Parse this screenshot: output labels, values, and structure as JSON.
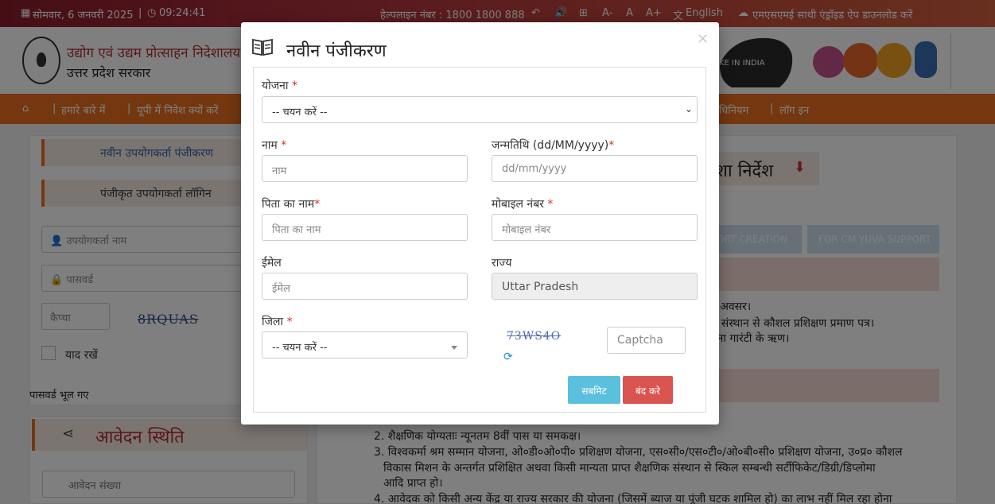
{
  "topbar": {
    "date": "सोमवार, 6 जनवरी 2025",
    "separator": "|",
    "time": "09:24:41",
    "helpline": "हेल्पलाइन नंबर : 1800 1800 888",
    "font_small": "A-",
    "font_normal": "A",
    "font_large": "A+",
    "language": "English",
    "app_download": "एमएसएमई साथी एंड्रॉइड ऐप डाउनलोड करें"
  },
  "header": {
    "department_line1": "उद्योग एवं उद्यम प्रोत्साहन निदेशालय",
    "department_line2": "उत्तर प्रदेश सरकार",
    "make_in_india": "KE IN INDIA"
  },
  "nav": {
    "items": [
      "हमारे बारे में",
      "यूपी में निवेश क्यों करें",
      "धिनियम",
      "लॉग इन"
    ]
  },
  "left_panel": {
    "tab_new_user": "नवीन उपयोगकर्ता पंजीकरण",
    "tab_login": "पंजीकृत उपयोगकर्ता लॉगिन",
    "username_placeholder": "उपयोगकर्ता नाम",
    "password_placeholder": "पासवर्ड",
    "captcha_placeholder": "कैप्चा",
    "captcha_text": "8RQUAS",
    "remember_label": "याद रखें",
    "forgot_password": "पासवर्ड भूल गए",
    "status_title": "आवेदन स्थिति",
    "application_number_placeholder": "आवेदन संख्या"
  },
  "right_panel": {
    "guidelines_title": "शा निर्देश",
    "button_project_report": "PORT CREATION",
    "button_cm_yuva": "FOR CM YUVA SUPPORT",
    "line1": "के अवसर।",
    "line2": "प्त संस्थान से कौशल प्रशिक्षण प्रमाण पत्र।",
    "line3": "बिना गारंटी के ऋण।",
    "list_item2": "2. शैक्षणिक योग्यताः न्यूनतम 8वीं पास या समकक्ष।",
    "list_item3a": "3. विश्वकर्मा श्रम सम्मान योजना, ओ०डी०ओ०पी० प्रशिक्षण योजना, एस०सी०/एस०टी०/ओ०बी०सी० प्रशिक्षण योजना, उ०प्र० कौशल",
    "list_item3b": "विकास मिशन के अन्तर्गत प्रशिक्षित अथवा किसी मान्यता प्राप्त शैक्षणिक संस्थान से स्किल सम्बन्धी सर्टीफिकेट/डिग्री/डिप्लोमा",
    "list_item3c": "आदि प्राप्त हो।",
    "list_item4": "4. आवेदक को किसी अन्य केंद्र या राज्य सरकार की योजना (जिसमें ब्याज या पूंजी घटक शामिल हो) का लाभ नहीं मिल रहा होना"
  },
  "modal": {
    "title": "नवीन पंजीकरण",
    "close_symbol": "×",
    "scheme_label": "योजना",
    "scheme_value": "-- चयन करें --",
    "name_label": "नाम",
    "name_placeholder": "नाम",
    "dob_label": "जन्मतिथि (dd/MM/yyyy)",
    "dob_placeholder": "dd/mm/yyyy",
    "father_label": "पिता का नाम",
    "father_placeholder": "पिता का नाम",
    "mobile_label": "मोबाइल नंबर",
    "mobile_placeholder": "मोबाइल नंबर",
    "email_label": "ईमेल",
    "email_placeholder": "ईमेल",
    "state_label": "राज्य",
    "state_value": "Uttar Pradesh",
    "district_label": "जिला",
    "district_value": "-- चयन करें --",
    "captcha_text": "73WS4O",
    "captcha_placeholder": "Captcha",
    "submit_label": "सबमिट",
    "close_label": "बंद करे",
    "required_mark": "*"
  },
  "colors": {
    "nav_orange": "#e96f1f",
    "brand_red": "#b32d2e",
    "submit_blue": "#5bc0de",
    "close_red": "#d9534f"
  }
}
